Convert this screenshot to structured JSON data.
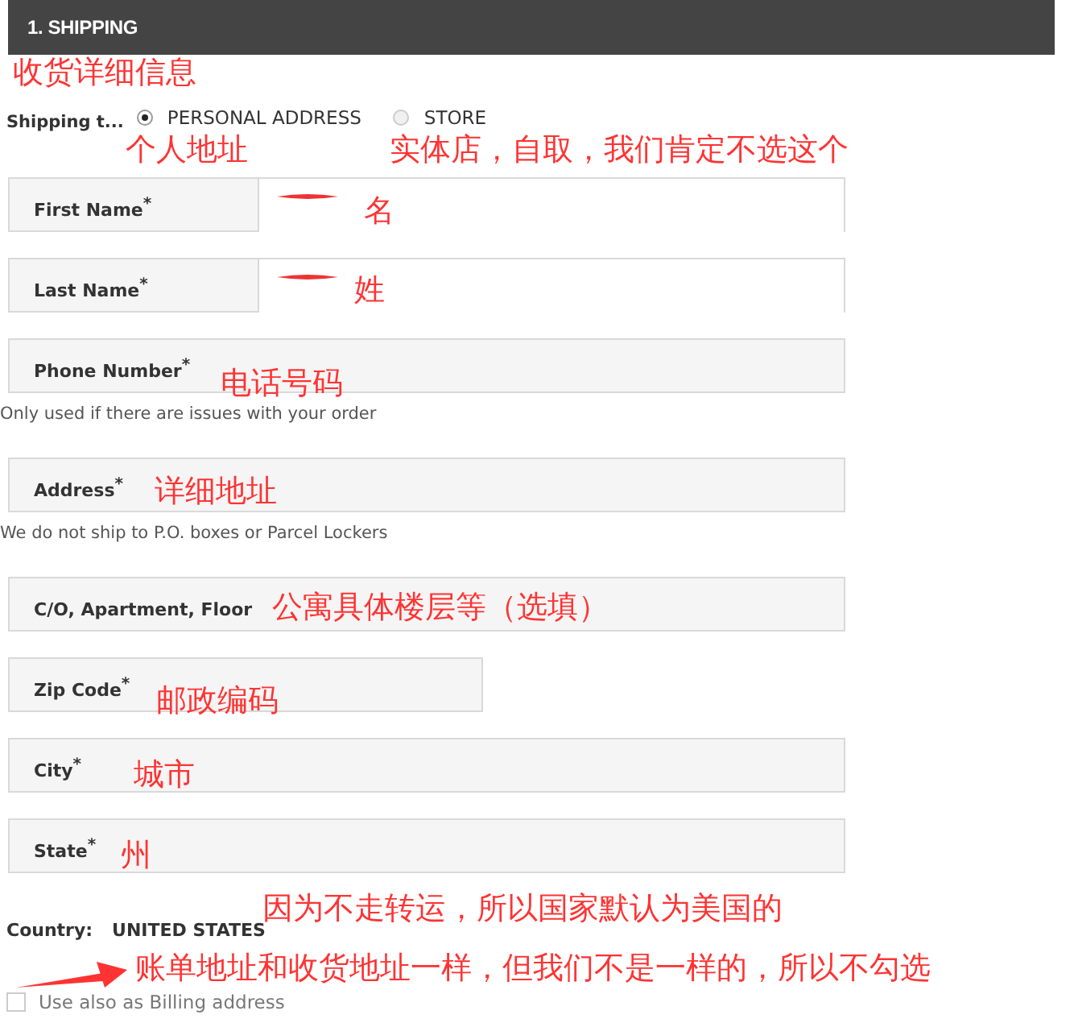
{
  "section_header": {
    "title": "1. SHIPPING"
  },
  "shipping_to": {
    "label": "Shipping t...",
    "options": [
      {
        "label": "PERSONAL ADDRESS",
        "selected": true
      },
      {
        "label": "STORE",
        "selected": false
      }
    ]
  },
  "fields": [
    {
      "kind": "split",
      "label": "First Name$^{*}$",
      "redacted": true
    },
    {
      "kind": "split",
      "label": "Last Name$^{*}$",
      "redacted": true
    },
    {
      "kind": "full",
      "label": "Phone Number$^{*}$",
      "hint": "Only used if there are issues with your order"
    },
    {
      "kind": "full",
      "label": "Address$^{*}$",
      "hint": "We do not ship to P.O. boxes or Parcel Lockers"
    },
    {
      "kind": "full",
      "label": "C/O, Apartment, Floor"
    },
    {
      "kind": "short",
      "label": "Zip Code$^{*}$"
    },
    {
      "kind": "full",
      "label": "City$^{*}$"
    },
    {
      "kind": "full",
      "label": "State$^{*}$"
    }
  ],
  "country": {
    "label": "Country:",
    "value": "UNITED STATES"
  },
  "billing_checkbox": {
    "label": "Use also as Billing address",
    "checked": false
  },
  "annotations": [
    {
      "text": "收货详细信息"
    },
    {
      "text": "个人地址"
    },
    {
      "text": "实体店，自取，我们肯定不选这个"
    },
    {
      "text": "名"
    },
    {
      "text": "姓"
    },
    {
      "text": "电话号码"
    },
    {
      "text": "详细地址"
    },
    {
      "text": "公寓具体楼层等（选填）"
    },
    {
      "text": "邮政编码"
    },
    {
      "text": "城市"
    },
    {
      "text": "州"
    },
    {
      "text": "因为不走转运，所以国家默认为美国的"
    },
    {
      "text": "账单地址和收货地址一样，但我们不是一样的，所以不勾选",
      "arrow": true
    }
  ]
}
